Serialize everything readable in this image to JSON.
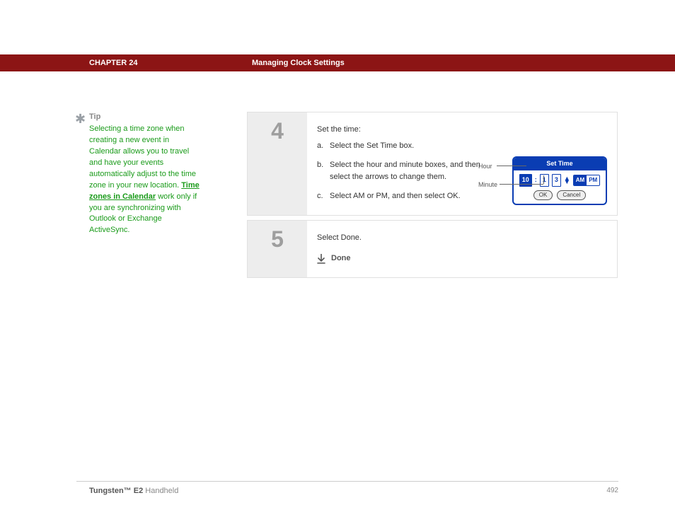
{
  "header": {
    "chapter": "CHAPTER 24",
    "title": "Managing Clock Settings"
  },
  "tip": {
    "label": "Tip",
    "body_pre": "Selecting a time zone when creating a new event in Calendar allows you to travel and have your events automatically adjust to the time zone in your new location. ",
    "link": "Time zones in Calendar",
    "body_post": " work only if you are synchronizing with Outlook or Exchange ActiveSync."
  },
  "steps": {
    "s4": {
      "num": "4",
      "intro": "Set the time:",
      "a": "Select the Set Time box.",
      "b": "Select the hour and minute boxes, and then select the arrows to change them.",
      "c": "Select AM or PM, and then select OK."
    },
    "s5": {
      "num": "5",
      "text": "Select Done.",
      "done": "Done"
    }
  },
  "dialog": {
    "title": "Set Time",
    "hour_label": "Hour",
    "minute_label": "Minute",
    "hour": "10",
    "minute_tens": "1",
    "minute_ones": "3",
    "am": "AM",
    "pm": "PM",
    "ok": "OK",
    "cancel": "Cancel"
  },
  "footer": {
    "product": "Tungsten™ E2",
    "suffix": " Handheld",
    "page": "492"
  }
}
